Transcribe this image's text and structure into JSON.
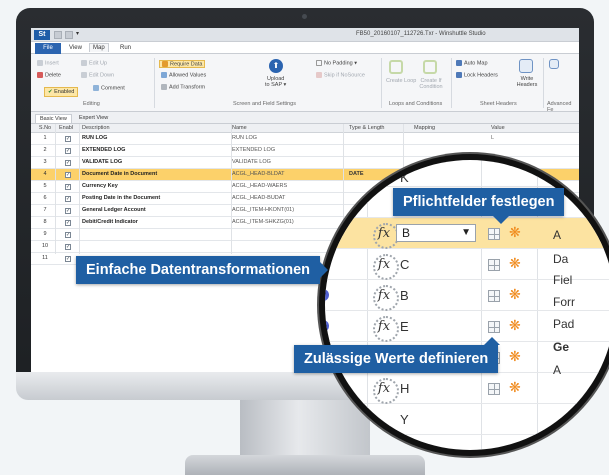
{
  "window": {
    "title": "FB50_20160107_112726.Txr - Winshuttle Studio",
    "logo": "St"
  },
  "menu": {
    "file": "File",
    "tabs": [
      "View",
      "Map",
      "Run"
    ],
    "active_tab": "Map"
  },
  "ribbon": {
    "editing": {
      "label": "Editing",
      "insert": "Insert",
      "delete": "Delete",
      "enabled": "Enabled",
      "edit_up": "Edit Up",
      "edit_down": "Edit Down",
      "comment": "Comment"
    },
    "screen_field": {
      "label": "Screen and Field Settings",
      "require_data": "Require Data",
      "allowed_values": "Allowed Values",
      "add_transform": "Add Transform",
      "upload": "Upload",
      "to_sap": "to SAP",
      "no_padding": "No Padding",
      "skip_if_no_source": "Skip if NoSource"
    },
    "loops": {
      "label": "Loops and Conditions",
      "create_loop": "Create Loop",
      "create_if": "Create If Condition"
    },
    "sheet_headers": {
      "label": "Sheet Headers",
      "auto_map": "Auto Map",
      "lock_headers": "Lock Headers",
      "write_headers": "Write Headers"
    },
    "advanced": {
      "label": "Advanced Fe"
    }
  },
  "view_tabs": [
    "Basic View",
    "Expert View"
  ],
  "grid": {
    "columns": [
      "S.No",
      "Enable",
      "Description",
      "Name",
      "Type & Length",
      "Mapping",
      "Value"
    ],
    "rows": [
      {
        "no": "1",
        "desc": "RUN LOG",
        "name": "RUN LOG",
        "type": "",
        "value": "L"
      },
      {
        "no": "2",
        "desc": "EXTENDED LOG",
        "name": "EXTENDED LOG",
        "type": "",
        "value": ""
      },
      {
        "no": "3",
        "desc": "VALIDATE LOG",
        "name": "VALIDATE LOG",
        "type": "",
        "value": ""
      },
      {
        "no": "4",
        "desc": "Document Date in Document",
        "name": "ACGL_HEAD-BLDAT",
        "type": "DATE",
        "value": ""
      },
      {
        "no": "5",
        "desc": "Currency Key",
        "name": "ACGL_HEAD-WAERS",
        "type": "",
        "value": ""
      },
      {
        "no": "6",
        "desc": "Posting Date in the Document",
        "name": "ACGL_HEAD-BUDAT",
        "type": "",
        "value": ""
      },
      {
        "no": "7",
        "desc": "General Ledger Account",
        "name": "ACGL_ITEM-HKONT(01)",
        "type": "",
        "value": ""
      },
      {
        "no": "8",
        "desc": "Debit/Credit Indicator",
        "name": "ACGL_ITEM-SHKZG(01)",
        "type": "",
        "value": ""
      },
      {
        "no": "9",
        "desc": "",
        "name": "",
        "type": "",
        "value": ""
      },
      {
        "no": "10",
        "desc": "",
        "name": "",
        "type": "",
        "value": ""
      },
      {
        "no": "11",
        "desc": "",
        "name": "",
        "type": "",
        "value": ""
      }
    ],
    "selected_row": 4
  },
  "magnifier": {
    "rows": [
      {
        "letter": "K"
      },
      {
        "letter": "J"
      },
      {
        "letter": "B",
        "dropdown": true
      },
      {
        "letter": "C"
      },
      {
        "letter": "B"
      },
      {
        "letter": "E"
      },
      {
        "letter": "F"
      },
      {
        "letter": "H"
      },
      {
        "letter": "Y"
      }
    ],
    "side_labels": [
      "A",
      "Da",
      "Fiel",
      "Forr",
      "Pad",
      "Ge",
      "A"
    ]
  },
  "callouts": {
    "required_fields": "Pflichtfelder festlegen",
    "simple_transforms": "Einfache Datentransformationen",
    "allowed_values": "Zulässige Werte definieren"
  },
  "colors": {
    "callout_blue": "#1f5fa3",
    "selected_row": "#fcd16a",
    "file_tab": "#2b64b0",
    "gear_orange": "#f08a1c"
  }
}
